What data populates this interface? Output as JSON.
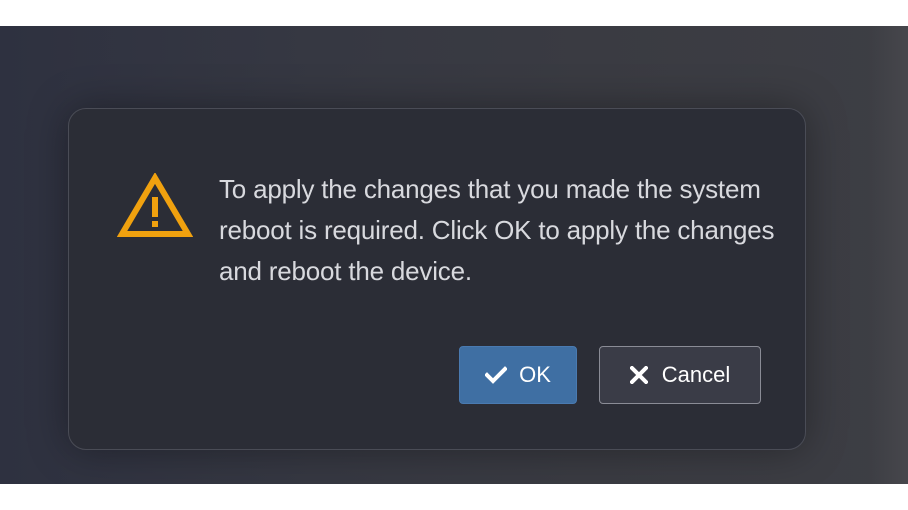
{
  "dialog": {
    "icon": "warning-triangle-icon",
    "message": "To apply the changes that you made the system reboot is required. Click OK to apply the changes and reboot the device.",
    "buttons": {
      "ok": {
        "label": "OK",
        "icon": "checkmark-icon"
      },
      "cancel": {
        "label": "Cancel",
        "icon": "close-icon"
      }
    }
  },
  "colors": {
    "warning": "#f0a10f",
    "primary_button": "#3f6fa3",
    "dialog_background": "#2b2d36",
    "backdrop": "#34363f"
  }
}
